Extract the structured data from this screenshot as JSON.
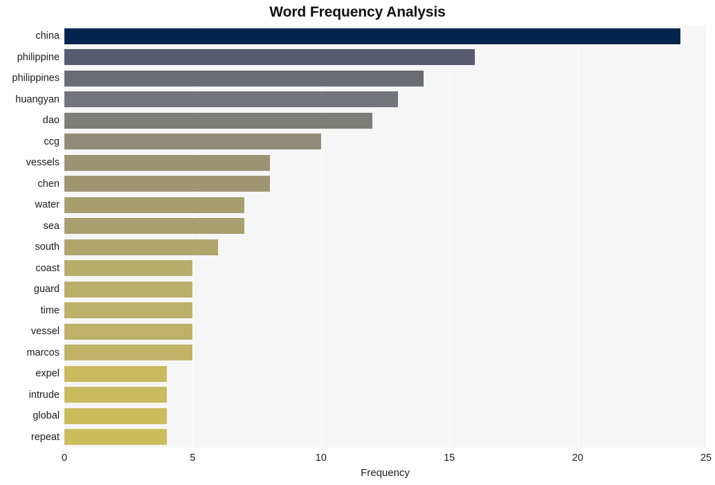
{
  "chart_data": {
    "type": "bar",
    "orientation": "horizontal",
    "title": "Word Frequency Analysis",
    "xlabel": "Frequency",
    "ylabel": "",
    "categories": [
      "china",
      "philippine",
      "philippines",
      "huangyan",
      "dao",
      "ccg",
      "vessels",
      "chen",
      "water",
      "sea",
      "south",
      "coast",
      "guard",
      "time",
      "vessel",
      "marcos",
      "expel",
      "intrude",
      "global",
      "repeat"
    ],
    "values": [
      24,
      16,
      14,
      13,
      12,
      10,
      8,
      8,
      7,
      7,
      6,
      5,
      5,
      5,
      5,
      5,
      4,
      4,
      4,
      4
    ],
    "bar_colors": [
      "#03244d",
      "#565b70",
      "#6a6b73",
      "#74757a",
      "#7e7e79",
      "#918c79",
      "#9b9472",
      "#9d9671",
      "#a79e6f",
      "#a89f6f",
      "#b1a56c",
      "#b9ac6b",
      "#bbae6a",
      "#bdb069",
      "#bfb168",
      "#c0b267",
      "#c9b95f",
      "#cabb5e",
      "#cbbc5d",
      "#ccbd5c"
    ],
    "xticks": [
      0,
      5,
      10,
      15,
      20,
      25
    ],
    "xlim": [
      0,
      25
    ],
    "grid": true,
    "gridline_color": "#ffffff",
    "plot_background": "#f6f6f7",
    "figure_background": "#ffffff",
    "legend": null
  }
}
